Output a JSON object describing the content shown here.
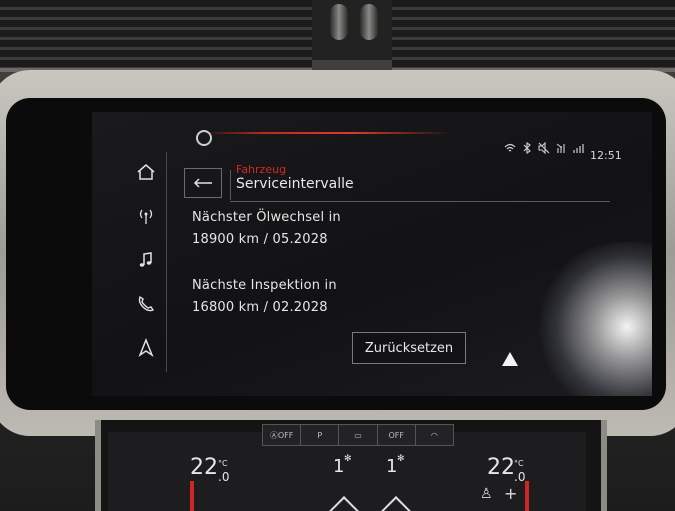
{
  "status_bar": {
    "clock": "12:51",
    "icons": [
      "user-profile-icon",
      "wifi-icon",
      "bluetooth-icon",
      "mute-icon",
      "signal-icon",
      "network-icon"
    ]
  },
  "nav_rail": {
    "items": [
      {
        "name": "home",
        "icon": "house-icon"
      },
      {
        "name": "radio",
        "icon": "antenna-icon"
      },
      {
        "name": "media",
        "icon": "music-note-icon"
      },
      {
        "name": "phone",
        "icon": "phone-icon"
      },
      {
        "name": "navigation",
        "icon": "navigation-arrow-icon"
      }
    ]
  },
  "header": {
    "breadcrumb": "Fahrzeug",
    "title": "Serviceintervalle"
  },
  "content": {
    "oil_label": "Nächster Ölwechsel in",
    "oil_value": "18900 km / 05.2028",
    "inspection_label": "Nächste Inspektion in",
    "inspection_value": "16800 km / 02.2028"
  },
  "actions": {
    "reset_label": "Zurücksetzen"
  },
  "climate": {
    "left_temp": "22",
    "left_temp_decimal": ".0",
    "right_temp": "22",
    "right_temp_decimal": ".0",
    "unit": "°C",
    "fan_left": "1",
    "fan_right": "1",
    "bar_labels": [
      "OFF",
      "P",
      "",
      "OFF",
      ""
    ],
    "plus_label": "+"
  },
  "colors": {
    "accent_red": "#d12a23",
    "text": "#e6e6e6",
    "screen_bg": "#121214"
  }
}
